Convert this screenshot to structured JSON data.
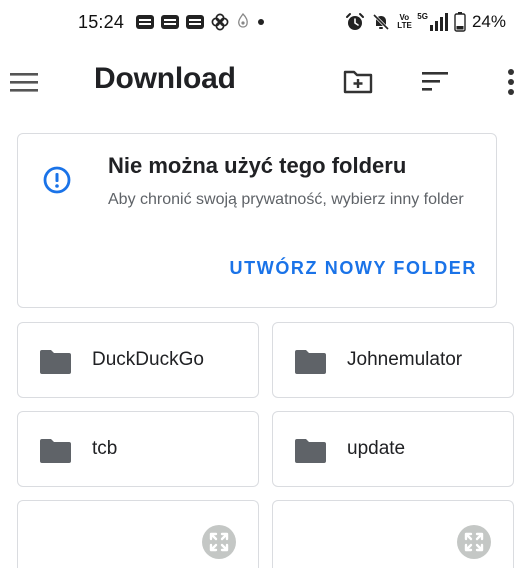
{
  "status_bar": {
    "time": "15:24",
    "network_label": "5G",
    "volte_label": "Vo LTE",
    "battery_percent": "24%"
  },
  "app_bar": {
    "title": "Download",
    "icons": [
      "menu-icon",
      "new-folder-icon",
      "sort-icon",
      "more-vert-icon"
    ]
  },
  "warning": {
    "title": "Nie można użyć tego folderu",
    "message": "Aby chronić swoją prywatność, wybierz inny folder",
    "action_label": "UTWÓRZ NOWY FOLDER",
    "accent_color": "#1a73e8"
  },
  "folders": [
    {
      "name": "DuckDuckGo"
    },
    {
      "name": "Johnemulator"
    },
    {
      "name": "tcb"
    },
    {
      "name": "update"
    }
  ]
}
